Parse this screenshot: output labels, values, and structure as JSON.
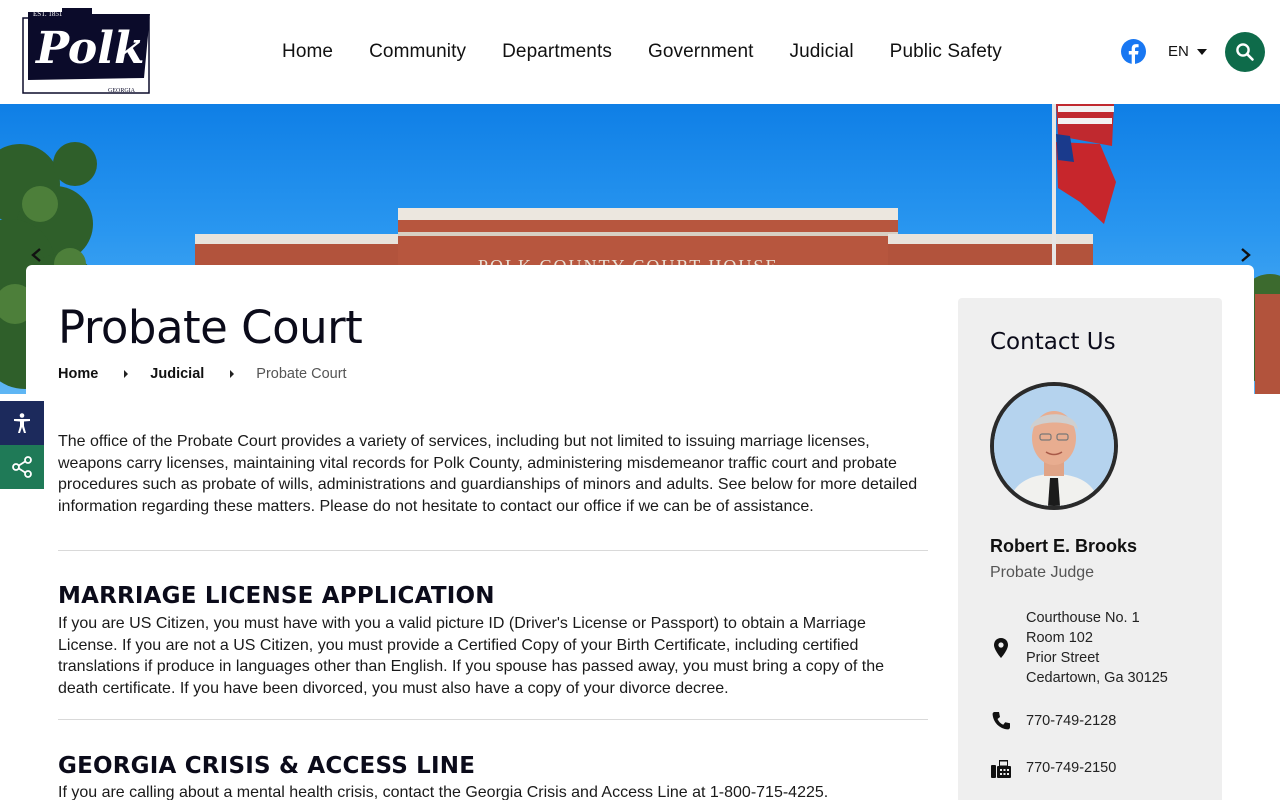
{
  "header": {
    "logo": {
      "est": "EST. 1851",
      "name": "Polk",
      "state": "GEORGIA"
    },
    "nav": [
      "Home",
      "Community",
      "Departments",
      "Government",
      "Judicial",
      "Public Safety"
    ],
    "language": "EN"
  },
  "page": {
    "title": "Probate Court",
    "breadcrumb": [
      "Home",
      "Judicial",
      "Probate Court"
    ],
    "intro": "The office of the Probate Court provides a variety of services, including but not limited to issuing marriage licenses, weapons carry licenses, maintaining vital records for Polk County, administering misdemeanor traffic court and probate procedures such as probate of wills, administrations and guardianships of minors and adults.  See below for more detailed information regarding these matters.  Please do not hesitate to contact our office if we can be of assistance.",
    "sections": [
      {
        "title": "MARRIAGE LICENSE APPLICATION",
        "body": "If you are US Citizen, you must have with you a valid picture ID (Driver's License or Passport) to obtain a Marriage License. If you are not a US Citizen, you must provide a Certified Copy of your Birth Certificate, including certified translations if produce in languages other than English. If you spouse has passed away, you must bring a copy of the death certificate. If you have been divorced, you must also have a copy of your divorce decree."
      },
      {
        "title": "GEORGIA CRISIS & ACCESS LINE",
        "body": "If you are calling about a mental health crisis, contact the Georgia Crisis and Access Line at 1-800-715-4225."
      }
    ]
  },
  "hero": {
    "building_text": "POLK  COUNTY  COURT  HOUSE"
  },
  "contact": {
    "title": "Contact Us",
    "name": "Robert E. Brooks",
    "role": "Probate Judge",
    "address": [
      "Courthouse No. 1",
      "Room 102",
      "Prior Street",
      "Cedartown, Ga 30125"
    ],
    "phone": "770-749-2128",
    "fax": "770-749-2150"
  },
  "colors": {
    "accent_green": "#0e6b4a",
    "a11y_navy": "#1c2a5c",
    "share_green": "#1f7a57",
    "facebook": "#1877f2"
  }
}
